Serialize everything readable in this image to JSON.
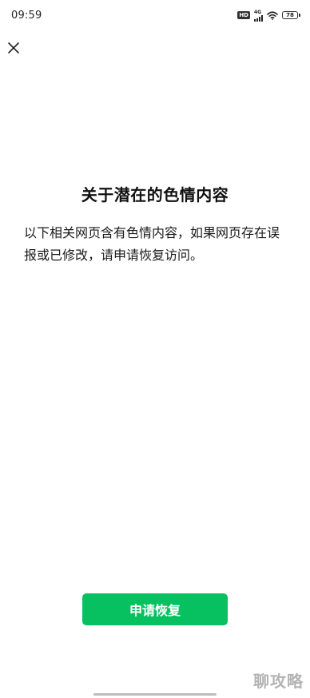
{
  "status_bar": {
    "time": "09:59",
    "hd_badge": "HD",
    "network_type": "4G",
    "battery_level": "78"
  },
  "notice": {
    "title": "关于潜在的色情内容",
    "description": "以下相关网页含有色情内容，如果网页存在误报或已修改，请申请恢复访问。"
  },
  "actions": {
    "restore_label": "申请恢复"
  },
  "watermark": {
    "text": "聊攻略"
  },
  "colors": {
    "primary_button": "#07c160",
    "background": "#ffffff",
    "text": "#1a1a1a"
  },
  "icons": {
    "close": "close-icon",
    "wifi": "wifi-icon",
    "signal": "signal-icon",
    "battery": "battery-icon"
  }
}
